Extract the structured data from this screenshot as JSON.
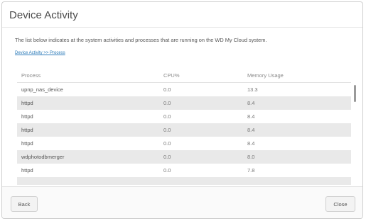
{
  "dialog": {
    "title": "Device Activity",
    "description": "The list below indicates at the system activities and processes that are running on the WD My Cloud system.",
    "link_text": "Device Activity >> Process",
    "table": {
      "columns": [
        "Process",
        "CPU%",
        "Memory Usage"
      ],
      "rows": [
        [
          "upnp_nas_device",
          "0.0",
          "13.3"
        ],
        [
          "httpd",
          "0.0",
          "8.4"
        ],
        [
          "httpd",
          "0.0",
          "8.4"
        ],
        [
          "httpd",
          "0.0",
          "8.4"
        ],
        [
          "httpd",
          "0.0",
          "8.4"
        ],
        [
          "wdphotodbmerger",
          "0.0",
          "8.0"
        ],
        [
          "httpd",
          "0.0",
          "7.8"
        ],
        [
          "",
          "",
          ""
        ]
      ]
    },
    "buttons": {
      "back": "Back",
      "close": "Close"
    }
  }
}
